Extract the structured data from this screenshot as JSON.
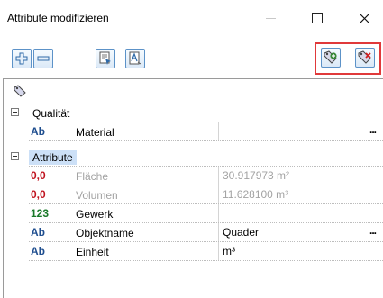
{
  "window": {
    "title": "Attribute modifizieren",
    "controls": {
      "minimize": "—",
      "maximize": "☐",
      "close": "✕"
    }
  },
  "toolbar": {
    "buttons": [
      {
        "name": "add-attribute-button",
        "icon": "plus-icon"
      },
      {
        "name": "remove-attribute-button",
        "icon": "minus-icon"
      },
      {
        "name": "pick-attribute-button",
        "icon": "pick-icon"
      },
      {
        "name": "text-attribute-button",
        "icon": "text-icon"
      },
      {
        "name": "add-tag-button",
        "icon": "tag-add-icon"
      },
      {
        "name": "delete-tag-button",
        "icon": "tag-delete-icon"
      }
    ],
    "highlight_color": "#e0393a"
  },
  "grid": {
    "groups": [
      {
        "label": "Qualität",
        "properties": [
          {
            "type_icon": "Ab",
            "name": "Material",
            "value": "",
            "has_ellipsis": true
          }
        ]
      },
      {
        "label": "Attribute",
        "selected": true,
        "properties": [
          {
            "type_icon": "0,0",
            "name": "Fläche",
            "value": "30.917973 m²",
            "disabled": true
          },
          {
            "type_icon": "0,0",
            "name": "Volumen",
            "value": "11.628100 m³",
            "disabled": true
          },
          {
            "type_icon": "123",
            "name": "Gewerk",
            "value": ""
          },
          {
            "type_icon": "Ab",
            "name": "Objektname",
            "value": "Quader",
            "has_ellipsis": true
          },
          {
            "type_icon": "Ab",
            "name": "Einheit",
            "value": "m³"
          }
        ]
      }
    ],
    "ellipsis_label": "..."
  }
}
